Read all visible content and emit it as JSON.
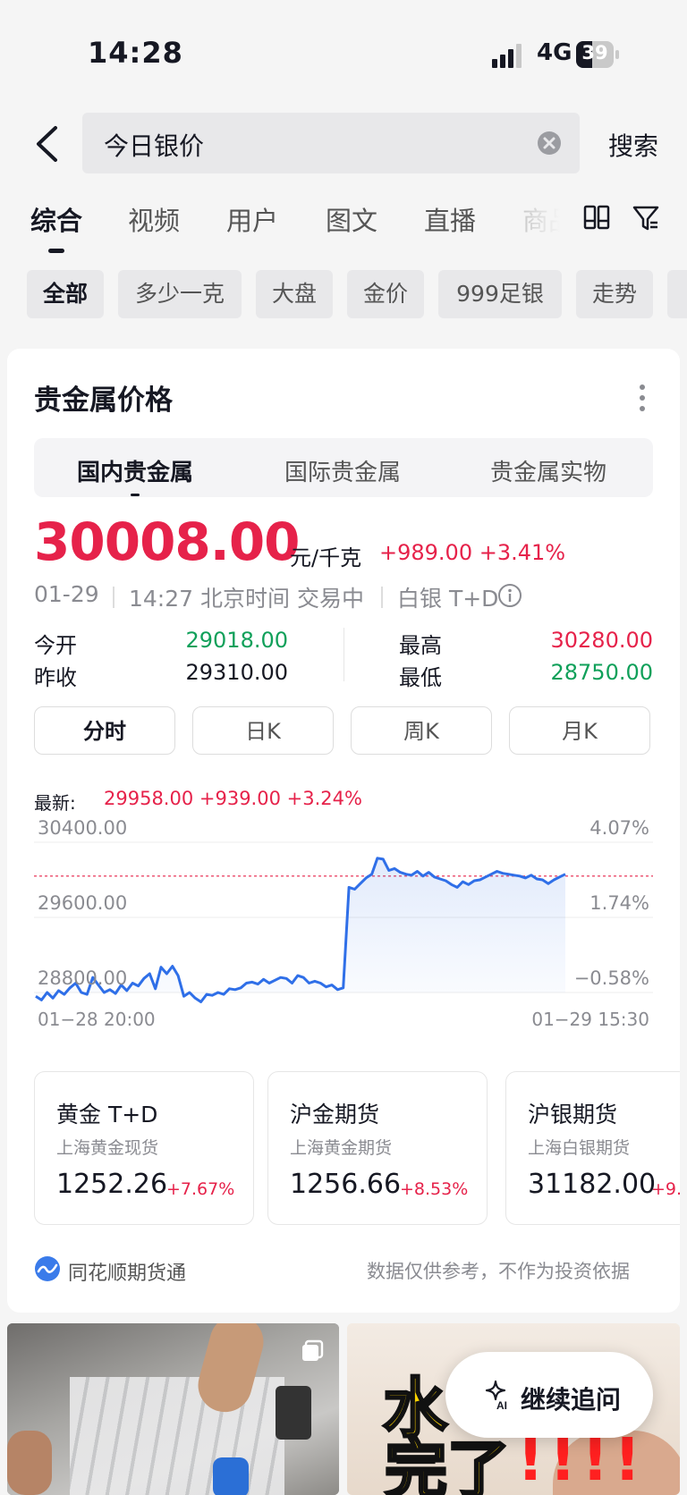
{
  "status_bar": {
    "time": "14:28",
    "network": "4G",
    "battery": "39"
  },
  "search": {
    "query": "今日银价",
    "button": "搜索"
  },
  "tabs": [
    {
      "label": "综合",
      "active": true
    },
    {
      "label": "视频"
    },
    {
      "label": "用户"
    },
    {
      "label": "图文"
    },
    {
      "label": "直播"
    },
    {
      "label": "商品"
    }
  ],
  "chips": [
    {
      "label": "全部",
      "active": true
    },
    {
      "label": "多少一克"
    },
    {
      "label": "大盘"
    },
    {
      "label": "金价"
    },
    {
      "label": "999足银"
    },
    {
      "label": "走势"
    }
  ],
  "card": {
    "title": "贵金属价格",
    "segments": [
      {
        "label": "国内贵金属",
        "active": true
      },
      {
        "label": "国际贵金属"
      },
      {
        "label": "贵金属实物"
      }
    ],
    "price": "30008.00",
    "unit": "元/千克",
    "change": "+989.00 +3.41%",
    "date": "01-29",
    "time": "14:27 北京时间 交易中",
    "contract": "白银 T+D",
    "stats": {
      "open_label": "今开",
      "open": "29018.00",
      "prev_label": "昨收",
      "prev": "29310.00",
      "high_label": "最高",
      "high": "30280.00",
      "low_label": "最低",
      "low": "28750.00"
    },
    "periods": [
      {
        "label": "分时",
        "active": true
      },
      {
        "label": "日K"
      },
      {
        "label": "周K"
      },
      {
        "label": "月K"
      }
    ],
    "latest_label": "最新:",
    "latest_value": "29958.00 +939.00 +3.24%",
    "axis": {
      "y_top": "30400.00",
      "y_mid": "29600.00",
      "y_bot": "28800.00",
      "pct_top": "4.07%",
      "pct_mid": "1.74%",
      "pct_bot": "−0.58%",
      "x_start": "01−28 20:00",
      "x_end": "01−29 15:30"
    },
    "mini_cards": [
      {
        "name": "黄金 T+D",
        "sub": "上海黄金现货",
        "price": "1252.26",
        "change": "+7.67%"
      },
      {
        "name": "沪金期货",
        "sub": "上海黄金期货",
        "price": "1256.66",
        "change": "+8.53%"
      },
      {
        "name": "沪银期货",
        "sub": "上海白银期货",
        "price": "31182.00",
        "change": "+9."
      }
    ],
    "footer_source": "同花顺期货通",
    "footer_note": "数据仅供参考，不作为投资依据"
  },
  "thumb_text": {
    "line1": "水",
    "line2": "完了",
    "exclaim": "!!!!"
  },
  "ai_button": "继续追问",
  "colors": {
    "up": "#e6224a",
    "down": "#10a05a",
    "line": "#2f6fe8"
  },
  "chart_data": {
    "type": "line",
    "x": [
      "01-28 20:00",
      "01-29 15:30"
    ],
    "ylim": [
      28800,
      30400
    ],
    "prev_close": 29310,
    "series": [
      {
        "values": [
          28760,
          28720,
          28800,
          28740,
          28820,
          28780,
          28850,
          28900,
          28800,
          28780,
          28960,
          28880,
          28800,
          28830,
          28790,
          28880,
          28820,
          28900,
          28870,
          28950,
          29000,
          28840,
          29070,
          29000,
          29080,
          28980,
          28760,
          28800,
          28740,
          28700,
          28780,
          28770,
          28800,
          28780,
          28840,
          28830,
          28850,
          28900,
          28910,
          28890,
          28940,
          28900,
          28930,
          28960,
          28950,
          28900,
          28980,
          28960,
          28900,
          28920,
          28900,
          28860,
          28880,
          28830,
          28850,
          29920,
          29900,
          29960,
          30020,
          30060,
          30230,
          30220,
          30100,
          30120,
          30080,
          30060,
          30050,
          30090,
          30040,
          30080,
          30030,
          30010,
          29990,
          29950,
          29920,
          29980,
          29950,
          29990,
          30000,
          30030,
          30060,
          30090,
          30070,
          30060,
          30050,
          30040,
          30020,
          30050,
          30010,
          30000,
          29960,
          30000,
          30030,
          30060
        ]
      }
    ]
  }
}
